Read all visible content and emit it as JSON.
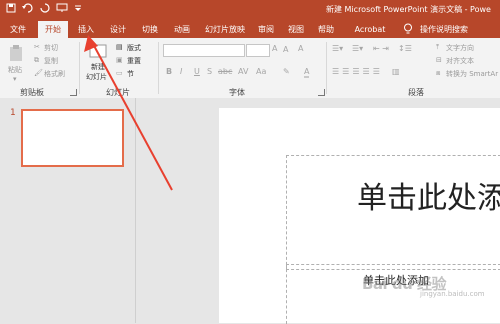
{
  "colors": {
    "accent": "#b7472a",
    "ribbon_bg": "#f3f3f3",
    "thumb_border": "#e46c4a",
    "arrow": "#e8402f"
  },
  "window": {
    "title": "新建 Microsoft PowerPoint 演示文稿 - Powe"
  },
  "qat": {
    "save_icon": "save-icon",
    "undo_icon": "undo-icon",
    "redo_icon": "redo-icon",
    "start_icon": "present-icon",
    "custom_icon": "customize-icon"
  },
  "tabs": [
    {
      "label": "文件"
    },
    {
      "label": "开始"
    },
    {
      "label": "插入"
    },
    {
      "label": "设计"
    },
    {
      "label": "切换"
    },
    {
      "label": "动画"
    },
    {
      "label": "幻灯片放映"
    },
    {
      "label": "审阅"
    },
    {
      "label": "视图"
    },
    {
      "label": "帮助"
    },
    {
      "label": "Acrobat"
    },
    {
      "label": "操作说明搜索"
    }
  ],
  "ribbon": {
    "clipboard": {
      "paste": "粘贴",
      "cut": "剪切",
      "copy": "复制",
      "format_painter": "格式刷",
      "label": "剪贴板"
    },
    "slides": {
      "new_slide_1": "新建",
      "new_slide_2": "幻灯片",
      "layout": "版式",
      "reset": "重置",
      "section": "节",
      "label": "幻灯片"
    },
    "font": {
      "label": "字体",
      "bold": "B",
      "italic": "I",
      "underline": "U",
      "strike": "S",
      "shadow": "abc",
      "spacing": "AV",
      "case": "Aa",
      "clear": "A"
    },
    "paragraph": {
      "label": "段落",
      "text_direction": "文字方向",
      "align_text": "对齐文本",
      "smartart": "转换为 SmartAr"
    }
  },
  "thumbnails": {
    "slide_number": "1"
  },
  "slide": {
    "title_placeholder": "单击此处添",
    "subtitle_placeholder": "单击此处添加"
  },
  "watermark": {
    "text": "Bai du 经验",
    "sub": "jingyan.baidu.com"
  }
}
